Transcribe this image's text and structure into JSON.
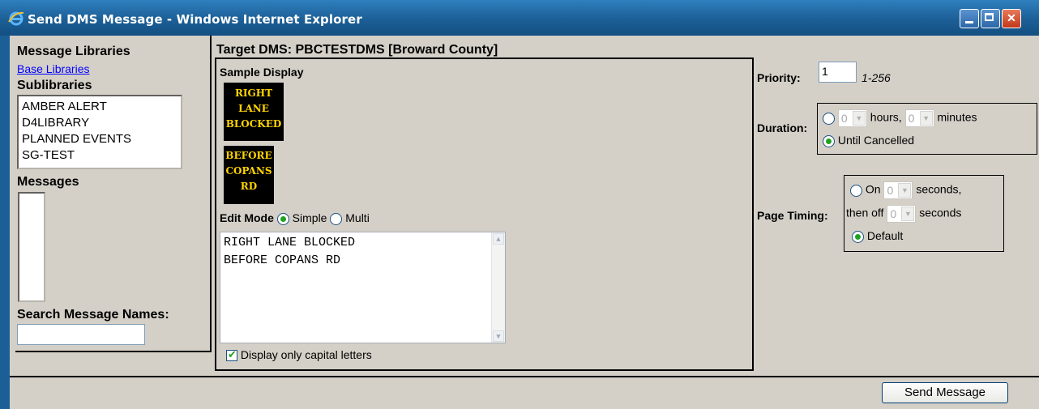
{
  "window": {
    "title": "Send DMS Message - Windows Internet Explorer",
    "controls": {
      "minimize": "minimize",
      "maximize": "maximize",
      "close": "close"
    }
  },
  "left": {
    "message_libraries_label": "Message Libraries",
    "base_libraries_link": "Base Libraries",
    "sublibraries_label": "Sublibraries",
    "sublibraries": [
      "AMBER ALERT",
      "D4LIBRARY",
      "PLANNED EVENTS",
      "SG-TEST"
    ],
    "messages_label": "Messages",
    "search_label": "Search Message Names:",
    "search_value": ""
  },
  "center": {
    "target_label": "Target DMS: PBCTESTDMS [Broward County]",
    "sample_display_label": "Sample Display",
    "sign_page_1": "RIGHT\nLANE\nBLOCKED",
    "sign_page_2": "BEFORE\nCOPANS\nRD",
    "edit_mode_label": "Edit Mode",
    "mode_simple": "Simple",
    "mode_multi": "Multi",
    "message_line_1": "RIGHT LANE BLOCKED",
    "message_line_2": "BEFORE COPANS RD",
    "caps_only_label": "Display only capital letters"
  },
  "right": {
    "priority_label": "Priority:",
    "priority_value": "1",
    "priority_range": "1-256",
    "duration_label": "Duration:",
    "hours_value": "0",
    "hours_label": "hours,",
    "minutes_value": "0",
    "minutes_label": "minutes",
    "until_cancelled_label": "Until Cancelled",
    "page_timing_label": "Page Timing:",
    "on_label": "On",
    "on_seconds_value": "0",
    "seconds_comma_label": "seconds,",
    "then_off_label": "then off",
    "off_seconds_value": "0",
    "seconds_label": "seconds",
    "default_label": "Default"
  },
  "footer": {
    "send_button": "Send Message"
  },
  "colors": {
    "title_bar": "#1c5f96",
    "client_bg": "#d4d0c8",
    "sign_text": "#ffd400",
    "sign_bg": "#000000"
  }
}
